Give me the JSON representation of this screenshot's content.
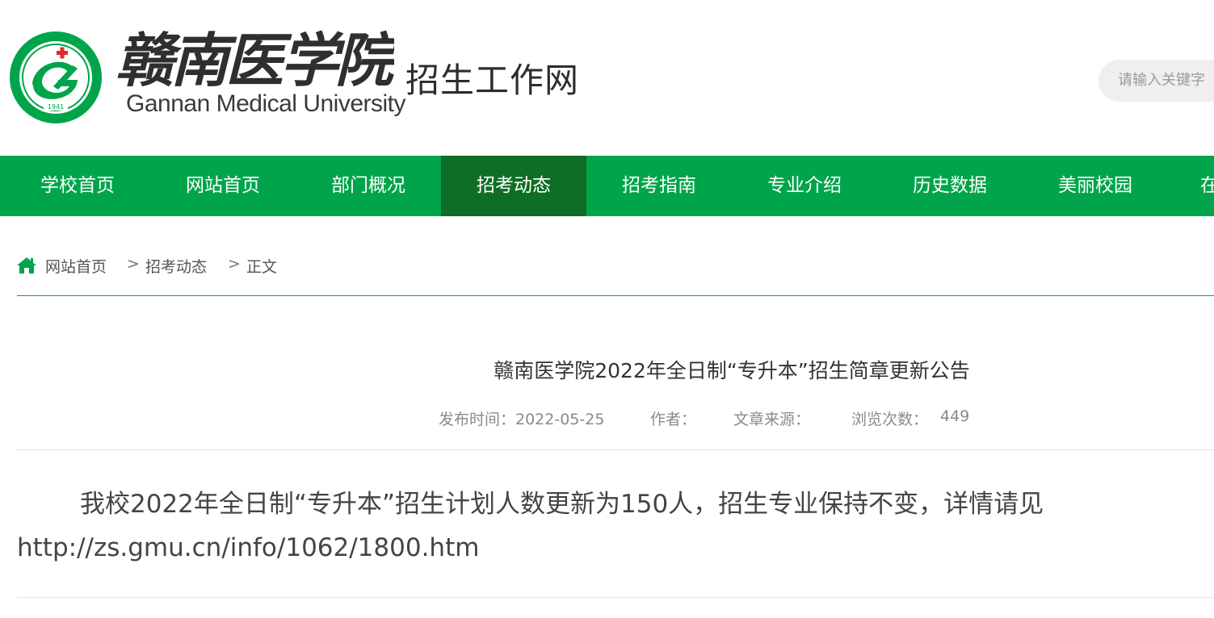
{
  "header": {
    "logo_cn": "赣南医学院",
    "logo_en": "Gannan Medical University",
    "emblem_year": "1941",
    "site_name": "招生工作网",
    "search_placeholder": "请输入关键字"
  },
  "colors": {
    "brand_green": "#00a44a",
    "nav_active": "#0f6e25",
    "emblem_red": "#e02b2b"
  },
  "nav": {
    "items": [
      {
        "label": "学校首页"
      },
      {
        "label": "网站首页"
      },
      {
        "label": "部门概况"
      },
      {
        "label": "招考动态",
        "active": true
      },
      {
        "label": "招考指南"
      },
      {
        "label": "专业介绍"
      },
      {
        "label": "历史数据"
      },
      {
        "label": "美丽校园"
      },
      {
        "label": "在"
      }
    ]
  },
  "breadcrumb": {
    "icon": "home-icon",
    "items": [
      "网站首页",
      "招考动态",
      "正文"
    ],
    "separator": ">"
  },
  "article": {
    "title": "赣南医学院2022年全日制“专升本”招生简章更新公告",
    "publish_label": "发布时间：2022-05-25",
    "author_label": "作者：",
    "source_label": "文章来源：",
    "views_label": "浏览次数：",
    "views_value": "449",
    "body_line1": "我校2022年全日制“专升本”招生计划人数更新为150人，招生专业保持不变，详情请见",
    "body_line2": "http://zs.gmu.cn/info/1062/1800.htm"
  }
}
